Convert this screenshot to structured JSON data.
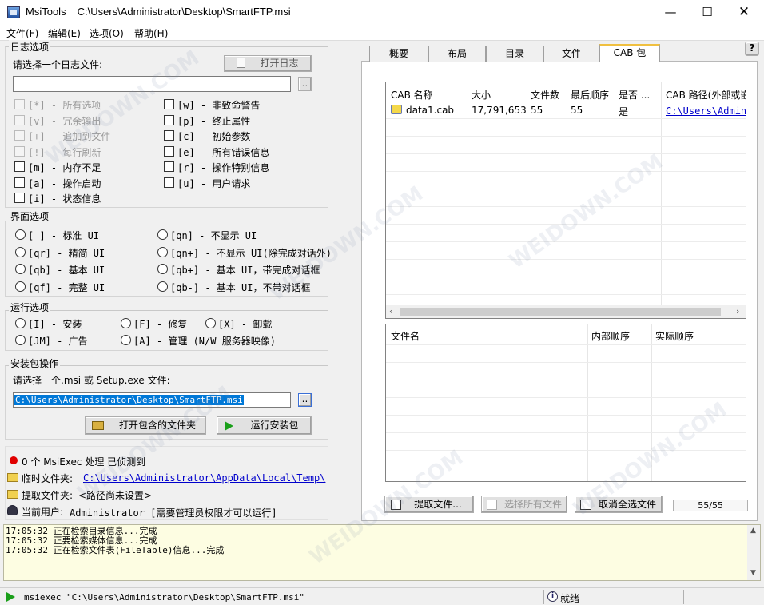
{
  "window": {
    "app_name": "MsiTools",
    "path": "C:\\Users\\Administrator\\Desktop\\SmartFTP.msi"
  },
  "menu": [
    "文件(F)",
    "编辑(E)",
    "选项(O)",
    "帮助(H)"
  ],
  "log": {
    "group": "日志选项",
    "prompt": "请选择一个日志文件:",
    "open_btn": "打开日志",
    "browse": "..",
    "options_left": [
      {
        "text": "[*] - 所有选项",
        "disabled": true
      },
      {
        "text": "[v] - 冗余输出",
        "disabled": true
      },
      {
        "text": "[+] - 追加到文件",
        "disabled": true
      },
      {
        "text": "[!] - 每行刷新",
        "disabled": true
      },
      {
        "text": "[m] - 内存不足",
        "disabled": false
      },
      {
        "text": "[a] - 操作启动",
        "disabled": false
      },
      {
        "text": "[i] - 状态信息",
        "disabled": false
      }
    ],
    "options_right": [
      {
        "text": "[w] - 非致命警告"
      },
      {
        "text": "[p] - 终止属性"
      },
      {
        "text": "[c] - 初始参数"
      },
      {
        "text": "[e] - 所有错误信息"
      },
      {
        "text": "[r] - 操作特别信息"
      },
      {
        "text": "[u] - 用户请求"
      }
    ]
  },
  "ui": {
    "group": "界面选项",
    "left": [
      "[ ] - 标准 UI",
      "[qr] - 精简 UI",
      "[qb] - 基本 UI",
      "[qf] - 完整 UI"
    ],
    "right": [
      "[qn] - 不显示 UI",
      "[qn+] - 不显示 UI(除完成对话外)",
      "[qb+] - 基本 UI，带完成对话框",
      "[qb-] - 基本 UI，不带对话框"
    ]
  },
  "run": {
    "group": "运行选项",
    "row1": [
      "[I] - 安装",
      "[F] - 修复",
      "[X] - 卸载"
    ],
    "row2": [
      "[JM] - 广告",
      "[A] - 管理 (N/W 服务器映像)"
    ]
  },
  "install": {
    "group": "安装包操作",
    "prompt": "请选择一个.msi 或 Setup.exe 文件:",
    "path": "C:\\Users\\Administrator\\Desktop\\SmartFTP.msi",
    "browse": "..",
    "open_folder_btn": "打开包含的文件夹",
    "run_btn": "运行安装包"
  },
  "status": {
    "msiexec": "0 个 MsiExec 处理  已侦测到",
    "temp_label": "临时文件夹:",
    "temp_path": "C:\\Users\\Administrator\\AppData\\Local\\Temp\\",
    "extract_label": "提取文件夹:",
    "extract_value": "<路径尚未设置>",
    "user_label": "当前用户:",
    "user_value": "Administrator  [需要管理员权限才可以运行]"
  },
  "tabs": [
    "概要",
    "布局",
    "目录",
    "文件",
    "CAB 包"
  ],
  "help_icon": "?",
  "cab_table": {
    "headers": [
      "CAB 名称",
      "大小",
      "文件数",
      "最后顺序",
      "是否 ...",
      "CAB 路径(外部或嵌"
    ],
    "rows": [
      {
        "name": "data1.cab",
        "size": "17,791,653",
        "files": "55",
        "last_seq": "55",
        "is": "是",
        "path": "C:\\Users\\Administ"
      }
    ]
  },
  "file_table": {
    "headers": [
      "文件名",
      "内部顺序",
      "实际顺序"
    ]
  },
  "actions": {
    "extract": "提取文件...",
    "select_all": "选择所有文件",
    "deselect_all": "取消全选文件",
    "count": "55/55"
  },
  "log_output": [
    "17:05:32 正在检索目录信息...完成",
    "17:05:32 正要检索媒体信息...完成",
    "17:05:32 正在检索文件表(FileTable)信息...完成"
  ],
  "statusbar": {
    "command": "msiexec  \"C:\\Users\\Administrator\\Desktop\\SmartFTP.msi\"",
    "state": "就绪"
  },
  "watermark": "WEIDOWN.COM"
}
